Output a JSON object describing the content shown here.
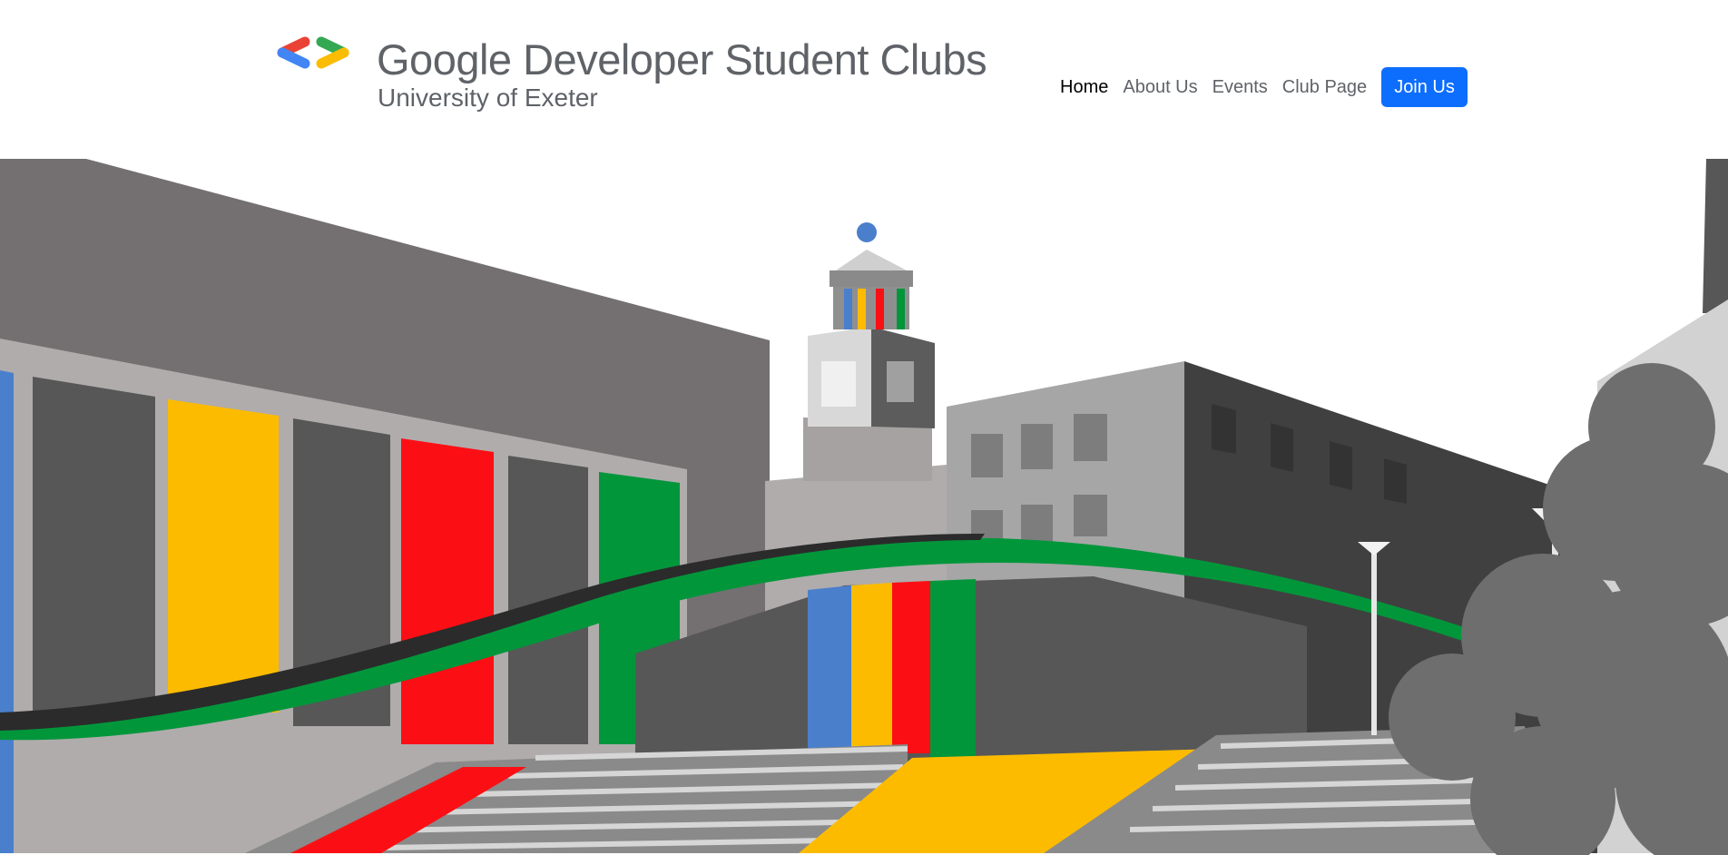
{
  "brand": {
    "title": "Google Developer Student Clubs",
    "subtitle": "University of Exeter",
    "logo_icon": "gdsc-brackets-icon",
    "logo_colors": [
      "#4285f4",
      "#ea4335",
      "#34a853",
      "#fbbc04"
    ]
  },
  "nav": {
    "items": [
      {
        "label": "Home",
        "active": true
      },
      {
        "label": "About Us",
        "active": false
      },
      {
        "label": "Events",
        "active": false
      },
      {
        "label": "Club Page",
        "active": false
      }
    ],
    "cta_label": "Join Us",
    "cta_color": "#0d6efd"
  },
  "hero": {
    "image": "campus-illustration",
    "colors": {
      "blue": "#4a7fcc",
      "yellow": "#fdbb00",
      "red": "#fb0f15",
      "green": "#02963b",
      "dark": "#575757",
      "mid": "#747071"
    }
  }
}
